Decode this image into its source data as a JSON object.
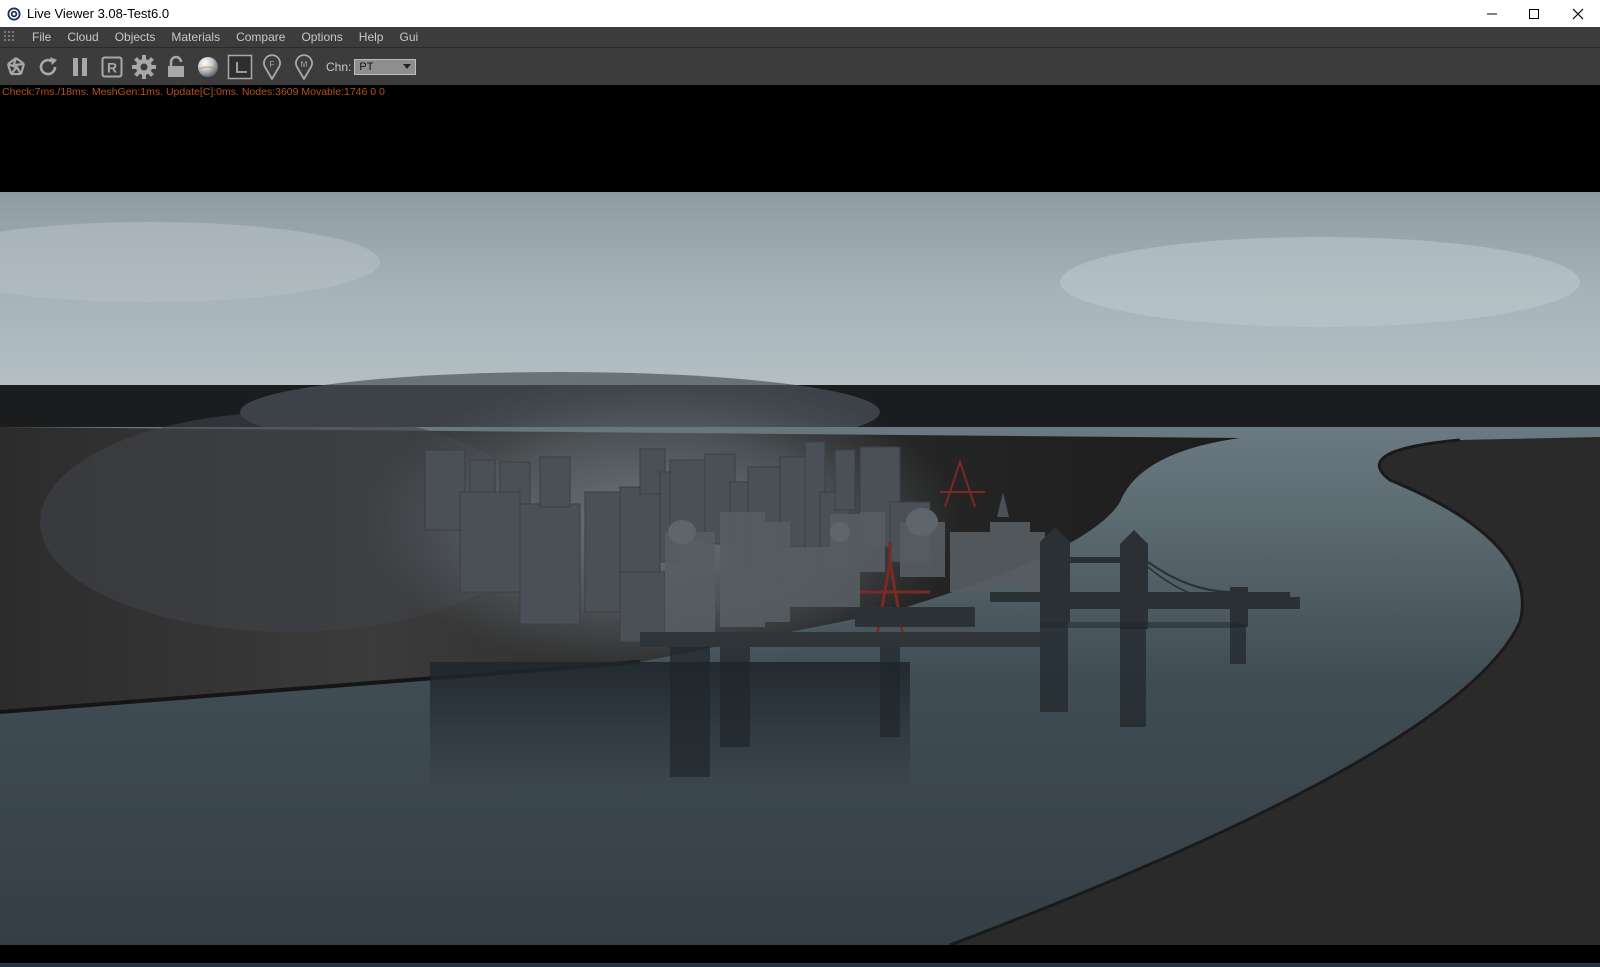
{
  "window": {
    "title": "Live Viewer 3.08-Test6.0",
    "buttons": [
      "minimize",
      "maximize",
      "close"
    ]
  },
  "menu": {
    "items": [
      "File",
      "Cloud",
      "Objects",
      "Materials",
      "Compare",
      "Options",
      "Help",
      "Gui"
    ]
  },
  "toolbar": {
    "icons": [
      "aperture-icon",
      "refresh-icon",
      "pause-icon",
      "r-icon",
      "gear-icon",
      "unlock-icon",
      "sphere-icon",
      "region-icon",
      "pin-f-icon",
      "pin-m-icon"
    ],
    "pin_f_letter": "F",
    "pin_m_letter": "M",
    "r_letter": "R",
    "chn_label": "Chn:",
    "chn_value": "PT"
  },
  "status": {
    "stats": "Check:7ms./18ms. MeshGen:1ms. Update[C]:0ms. Nodes:3609 Movable:1746  0 0"
  },
  "colors": {
    "menubar_bg": "#3c3c3c",
    "stats_text": "#b4531c",
    "viewport_bg": "#000000"
  }
}
